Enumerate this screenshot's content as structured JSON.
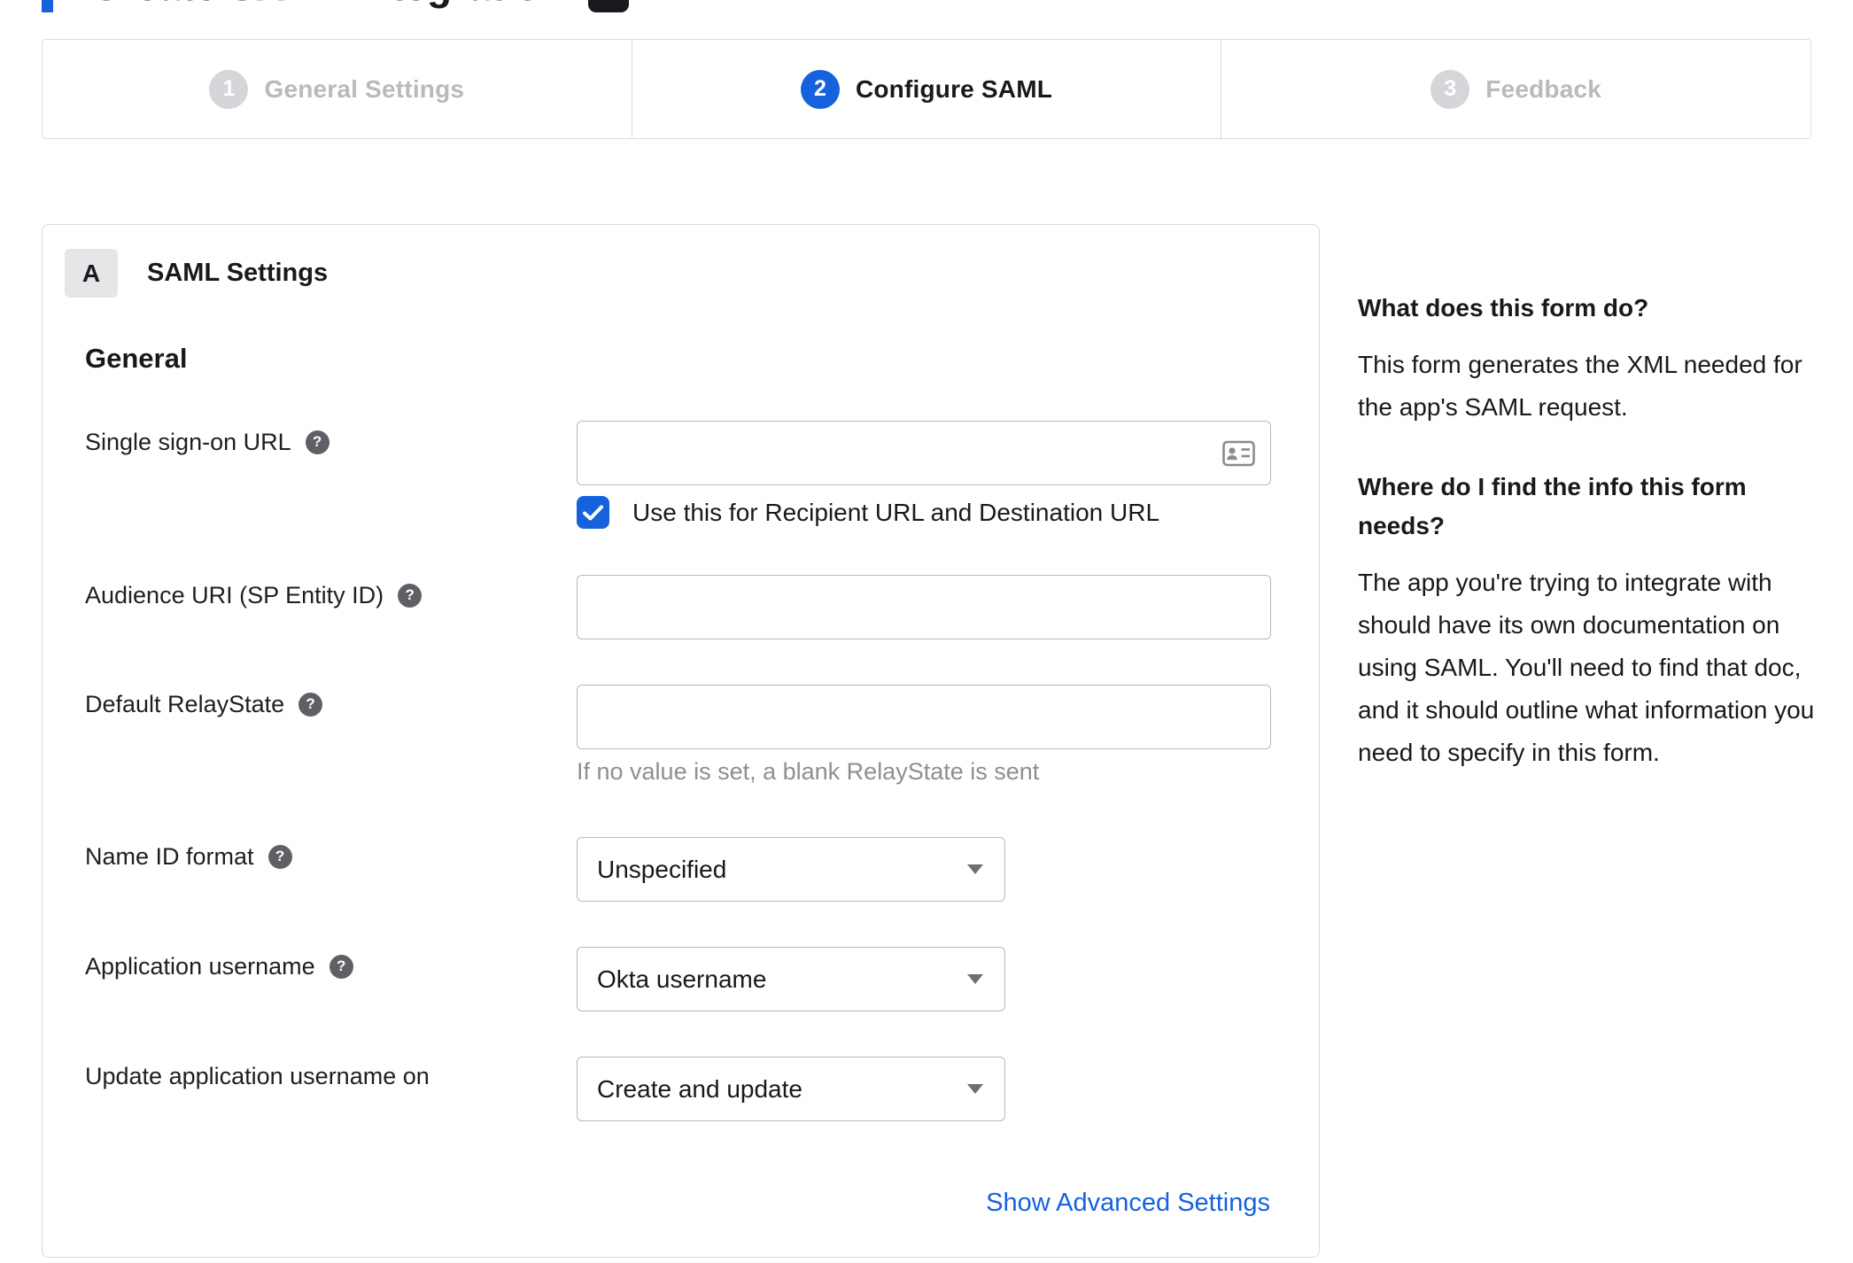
{
  "page": {
    "clipped_title": "Create SAML Integration"
  },
  "stepper": {
    "steps": [
      {
        "number": "1",
        "label": "General Settings"
      },
      {
        "number": "2",
        "label": "Configure SAML"
      },
      {
        "number": "3",
        "label": "Feedback"
      }
    ]
  },
  "form": {
    "section_badge": "A",
    "section_title": "SAML Settings",
    "group_heading": "General",
    "sso": {
      "label": "Single sign-on URL",
      "value": "",
      "checkbox_label": "Use this for Recipient URL and Destination URL",
      "checked": true
    },
    "audience": {
      "label": "Audience URI (SP Entity ID)",
      "value": ""
    },
    "relay": {
      "label": "Default RelayState",
      "value": "",
      "hint": "If no value is set, a blank RelayState is sent"
    },
    "name_id": {
      "label": "Name ID format",
      "value": "Unspecified"
    },
    "app_username": {
      "label": "Application username",
      "value": "Okta username"
    },
    "update_username": {
      "label": "Update application username on",
      "value": "Create and update"
    },
    "advanced_link": "Show Advanced Settings",
    "help_icon_glyph": "?"
  },
  "help": {
    "q1_title": "What does this form do?",
    "q1_body": "This form generates the XML needed for the app's SAML request.",
    "q2_title": "Where do I find the info this form needs?",
    "q2_body": "The app you're trying to integrate with should have its own documentation on using SAML. You'll need to find that doc, and it should outline what information you need to specify in this form."
  },
  "colors": {
    "accent_blue": "#1662dd",
    "inactive_gray": "#b9b9be",
    "text_dark": "#17191d"
  }
}
